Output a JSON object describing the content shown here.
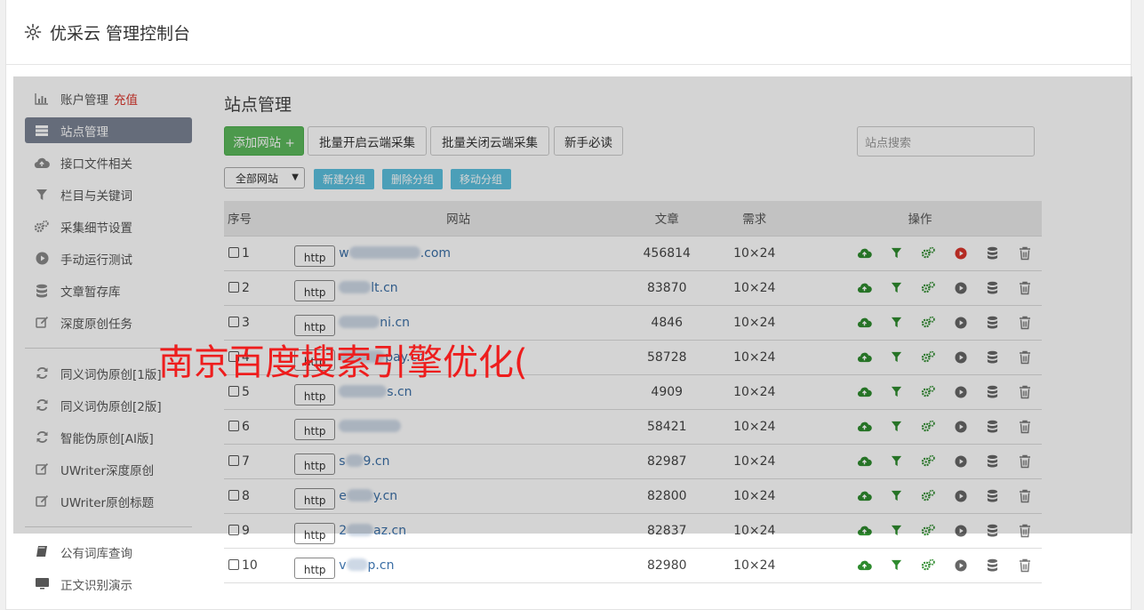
{
  "header": {
    "title": "优采云 管理控制台",
    "icon": "gear-icon"
  },
  "sidebar": {
    "items": [
      {
        "label": "账户管理",
        "badge": "充值",
        "icon": "bar-chart-icon"
      },
      {
        "label": "站点管理",
        "icon": "server-icon",
        "active": true
      },
      {
        "label": "接口文件相关",
        "icon": "cloud-upload-icon"
      },
      {
        "label": "栏目与关键词",
        "icon": "filter-icon"
      },
      {
        "label": "采集细节设置",
        "icon": "gears-icon"
      },
      {
        "label": "手动运行测试",
        "icon": "play-circle-icon"
      },
      {
        "label": "文章暂存库",
        "icon": "database-icon"
      },
      {
        "label": "深度原创任务",
        "icon": "edit-icon"
      },
      {
        "label": "同义词伪原创[1版]",
        "icon": "refresh-icon"
      },
      {
        "label": "同义词伪原创[2版]",
        "icon": "refresh-icon"
      },
      {
        "label": "智能伪原创[AI版]",
        "icon": "refresh-icon"
      },
      {
        "label": "UWriter深度原创",
        "icon": "edit-icon"
      },
      {
        "label": "UWriter原创标题",
        "icon": "edit-icon"
      },
      {
        "label": "公有词库查询",
        "icon": "book-icon"
      },
      {
        "label": "正文识别演示",
        "icon": "monitor-icon"
      }
    ]
  },
  "main": {
    "title": "站点管理",
    "toolbar": {
      "add_site": "添加网站 +",
      "batch_open": "批量开启云端采集",
      "batch_close": "批量关闭云端采集",
      "newbie": "新手必读",
      "search_placeholder": "站点搜索"
    },
    "group": {
      "select_value": "全部网站",
      "new_group": "新建分组",
      "delete_group": "删除分组",
      "move_group": "移动分组"
    },
    "table": {
      "headers": [
        "序号",
        "网站",
        "文章",
        "需求",
        "操作"
      ],
      "rows": [
        {
          "no": "1",
          "protocol": "http",
          "prefix": "w",
          "suffix": ".com",
          "articles": "456814",
          "demand": "10×24",
          "running": true
        },
        {
          "no": "2",
          "protocol": "http",
          "prefix": "",
          "suffix": "lt.cn",
          "articles": "83870",
          "demand": "10×24",
          "running": false
        },
        {
          "no": "3",
          "protocol": "http",
          "prefix": "",
          "suffix": "ni.cn",
          "articles": "4846",
          "demand": "10×24",
          "running": false
        },
        {
          "no": "4",
          "protocol": "http",
          "prefix": "",
          "suffix": "pay.cn",
          "articles": "58728",
          "demand": "10×24",
          "running": false
        },
        {
          "no": "5",
          "protocol": "http",
          "prefix": "",
          "suffix": "s.cn",
          "articles": "4909",
          "demand": "10×24",
          "running": false
        },
        {
          "no": "6",
          "protocol": "http",
          "prefix": "",
          "suffix": "",
          "articles": "58421",
          "demand": "10×24",
          "running": false
        },
        {
          "no": "7",
          "protocol": "http",
          "prefix": "s",
          "suffix": "9.cn",
          "articles": "82987",
          "demand": "10×24",
          "running": false
        },
        {
          "no": "8",
          "protocol": "http",
          "prefix": "e",
          "suffix": "y.cn",
          "articles": "82800",
          "demand": "10×24",
          "running": false
        },
        {
          "no": "9",
          "protocol": "http",
          "prefix": "2",
          "suffix": "az.cn",
          "articles": "82837",
          "demand": "10×24",
          "running": false
        },
        {
          "no": "10",
          "protocol": "http",
          "prefix": "v",
          "suffix": "p.cn",
          "articles": "82980",
          "demand": "10×24",
          "running": false
        }
      ],
      "op_icons": [
        "cloud-upload-icon",
        "filter-icon",
        "gears-icon",
        "play-circle-icon",
        "database-icon",
        "trash-icon"
      ]
    }
  },
  "watermark": "南京百度搜索引擎优化(",
  "colors": {
    "green": "#5cb85c",
    "info": "#5bc0de",
    "link": "#3a6ea5",
    "active_nav": "#7a8393",
    "danger": "#d9342b",
    "op_green": "#2e8b2e"
  }
}
